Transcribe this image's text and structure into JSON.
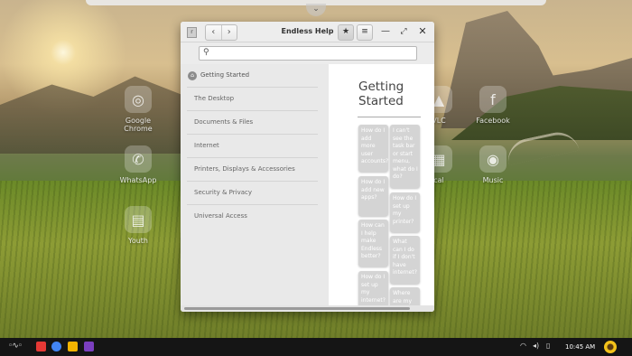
{
  "desktop": {
    "icons": [
      {
        "label": "Google Chrome",
        "glyph": "◎"
      },
      {
        "label": "WhatsApp",
        "glyph": "✆"
      },
      {
        "label": "Youth",
        "glyph": "▤"
      },
      {
        "label": "VLC",
        "glyph": "▲"
      },
      {
        "label": "Facebook",
        "glyph": "f"
      },
      {
        "label": "Music",
        "glyph": "◉"
      },
      {
        "label": "cal",
        "glyph": "▦"
      }
    ]
  },
  "window": {
    "title": "Endless Help",
    "app_icon": "r",
    "nav_back": "‹",
    "nav_forward": "›",
    "bookmark_glyph": "★",
    "menu_glyph": "≡",
    "minimize_glyph": "—",
    "maximize_glyph": "⤢",
    "close_glyph": "✕"
  },
  "search": {
    "placeholder": "",
    "value": ""
  },
  "sidebar": {
    "items": [
      {
        "label": "Getting Started"
      },
      {
        "label": "The Desktop"
      },
      {
        "label": "Documents & Files"
      },
      {
        "label": "Internet"
      },
      {
        "label": "Printers, Displays & Accessories"
      },
      {
        "label": "Security & Privacy"
      },
      {
        "label": "Universal Access"
      }
    ]
  },
  "main": {
    "title": "Getting Started",
    "cards": [
      "How do I add more user accounts?",
      "I can't see the task bar or start menu, what do I do?",
      "How do I add new apps?",
      "How do I set up my printer?",
      "How can I help make Endless better?",
      "What can I do if I don't have internet?",
      "How do I set up my internet?",
      "Where are my"
    ]
  },
  "taskbar": {
    "clock": "10:45 AM",
    "apps": [
      {
        "name": "app-grid",
        "color": "#e53935"
      },
      {
        "name": "chrome",
        "color": "#4285f4"
      },
      {
        "name": "files",
        "color": "#f4b400"
      },
      {
        "name": "help",
        "color": "#7b3fbf"
      }
    ]
  }
}
